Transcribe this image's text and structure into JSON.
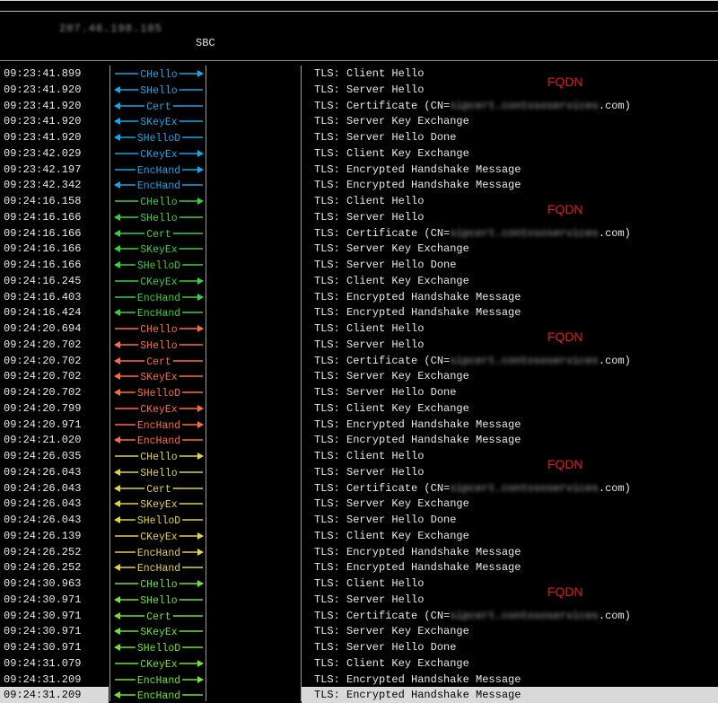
{
  "header": {
    "host_ip": "207.46.198.185",
    "sbc_label": "SBC"
  },
  "fqdn_label": "FQDN",
  "messages": [
    {
      "time": "09:23:41.899",
      "arrow": "CHello",
      "dir": "right",
      "color": "#19a6e6",
      "desc": "TLS: Client Hello"
    },
    {
      "time": "09:23:41.920",
      "arrow": "SHello",
      "dir": "left",
      "color": "#19a6e6",
      "desc": "TLS: Server Hello"
    },
    {
      "time": "09:23:41.920",
      "arrow": "Cert",
      "dir": "left",
      "color": "#19a6e6",
      "desc_prefix": "TLS: Certificate (CN=",
      "desc_blurred": "sipcert.contososervices",
      "desc_suffix": ".com)"
    },
    {
      "time": "09:23:41.920",
      "arrow": "SKeyEx",
      "dir": "left",
      "color": "#19a6e6",
      "desc": "TLS: Server Key Exchange"
    },
    {
      "time": "09:23:41.920",
      "arrow": "SHelloD",
      "dir": "left",
      "color": "#19a6e6",
      "desc": "TLS: Server Hello Done"
    },
    {
      "time": "09:23:42.029",
      "arrow": "CKeyEx",
      "dir": "right",
      "color": "#19a6e6",
      "desc": "TLS: Client Key Exchange"
    },
    {
      "time": "09:23:42.197",
      "arrow": "EncHand",
      "dir": "right",
      "color": "#19a6e6",
      "desc": "TLS: Encrypted Handshake Message"
    },
    {
      "time": "09:23:42.342",
      "arrow": "EncHand",
      "dir": "left",
      "color": "#19a6e6",
      "desc": "TLS: Encrypted Handshake Message"
    },
    {
      "time": "09:24:16.158",
      "arrow": "CHello",
      "dir": "right",
      "color": "#3ccf3c",
      "desc": "TLS: Client Hello"
    },
    {
      "time": "09:24:16.166",
      "arrow": "SHello",
      "dir": "left",
      "color": "#3ccf3c",
      "desc": "TLS: Server Hello"
    },
    {
      "time": "09:24:16.166",
      "arrow": "Cert",
      "dir": "left",
      "color": "#3ccf3c",
      "desc_prefix": "TLS: Certificate (CN=",
      "desc_blurred": "sipcert.contososervices",
      "desc_suffix": ".com)"
    },
    {
      "time": "09:24:16.166",
      "arrow": "SKeyEx",
      "dir": "left",
      "color": "#3ccf3c",
      "desc": "TLS: Server Key Exchange"
    },
    {
      "time": "09:24:16.166",
      "arrow": "SHelloD",
      "dir": "left",
      "color": "#3ccf3c",
      "desc": "TLS: Server Hello Done"
    },
    {
      "time": "09:24:16.245",
      "arrow": "CKeyEx",
      "dir": "right",
      "color": "#3ccf3c",
      "desc": "TLS: Client Key Exchange"
    },
    {
      "time": "09:24:16.403",
      "arrow": "EncHand",
      "dir": "right",
      "color": "#3ccf3c",
      "desc": "TLS: Encrypted Handshake Message"
    },
    {
      "time": "09:24:16.424",
      "arrow": "EncHand",
      "dir": "left",
      "color": "#3ccf3c",
      "desc": "TLS: Encrypted Handshake Message"
    },
    {
      "time": "09:24:20.694",
      "arrow": "CHello",
      "dir": "right",
      "color": "#ff6b3d",
      "desc": "TLS: Client Hello"
    },
    {
      "time": "09:24:20.702",
      "arrow": "SHello",
      "dir": "left",
      "color": "#ff6b3d",
      "desc": "TLS: Server Hello"
    },
    {
      "time": "09:24:20.702",
      "arrow": "Cert",
      "dir": "left",
      "color": "#ff6b3d",
      "desc_prefix": "TLS: Certificate (CN=",
      "desc_blurred": "sipcert.contososervices",
      "desc_suffix": ".com)"
    },
    {
      "time": "09:24:20.702",
      "arrow": "SKeyEx",
      "dir": "left",
      "color": "#ff6b3d",
      "desc": "TLS: Server Key Exchange"
    },
    {
      "time": "09:24:20.702",
      "arrow": "SHelloD",
      "dir": "left",
      "color": "#ff6b3d",
      "desc": "TLS: Server Hello Done"
    },
    {
      "time": "09:24:20.799",
      "arrow": "CKeyEx",
      "dir": "right",
      "color": "#ff6b3d",
      "desc": "TLS: Client Key Exchange"
    },
    {
      "time": "09:24:20.971",
      "arrow": "EncHand",
      "dir": "right",
      "color": "#ff6b3d",
      "desc": "TLS: Encrypted Handshake Message"
    },
    {
      "time": "09:24:21.020",
      "arrow": "EncHand",
      "dir": "left",
      "color": "#ff6b3d",
      "desc": "TLS: Encrypted Handshake Message"
    },
    {
      "time": "09:24:26.035",
      "arrow": "CHello",
      "dir": "right",
      "color": "#e0d34a",
      "desc": "TLS: Client Hello"
    },
    {
      "time": "09:24:26.043",
      "arrow": "SHello",
      "dir": "left",
      "color": "#e0d34a",
      "desc": "TLS: Server Hello"
    },
    {
      "time": "09:24:26.043",
      "arrow": "Cert",
      "dir": "left",
      "color": "#e0d34a",
      "desc_prefix": "TLS: Certificate (CN=",
      "desc_blurred": "sipcert.contososervices",
      "desc_suffix": ".com)"
    },
    {
      "time": "09:24:26.043",
      "arrow": "SKeyEx",
      "dir": "left",
      "color": "#e0d34a",
      "desc": "TLS: Server Key Exchange"
    },
    {
      "time": "09:24:26.043",
      "arrow": "SHelloD",
      "dir": "left",
      "color": "#e0d34a",
      "desc": "TLS: Server Hello Done"
    },
    {
      "time": "09:24:26.139",
      "arrow": "CKeyEx",
      "dir": "right",
      "color": "#e0d34a",
      "desc": "TLS: Client Key Exchange"
    },
    {
      "time": "09:24:26.252",
      "arrow": "EncHand",
      "dir": "right",
      "color": "#e0d34a",
      "desc": "TLS: Encrypted Handshake Message"
    },
    {
      "time": "09:24:26.252",
      "arrow": "EncHand",
      "dir": "left",
      "color": "#e0d34a",
      "desc": "TLS: Encrypted Handshake Message"
    },
    {
      "time": "09:24:30.963",
      "arrow": "CHello",
      "dir": "right",
      "color": "#6ee23a",
      "desc": "TLS: Client Hello"
    },
    {
      "time": "09:24:30.971",
      "arrow": "SHello",
      "dir": "left",
      "color": "#6ee23a",
      "desc": "TLS: Server Hello"
    },
    {
      "time": "09:24:30.971",
      "arrow": "Cert",
      "dir": "left",
      "color": "#6ee23a",
      "desc_prefix": "TLS: Certificate (CN=",
      "desc_blurred": "sipcert.contososervices",
      "desc_suffix": ".com)"
    },
    {
      "time": "09:24:30.971",
      "arrow": "SKeyEx",
      "dir": "left",
      "color": "#6ee23a",
      "desc": "TLS: Server Key Exchange"
    },
    {
      "time": "09:24:30.971",
      "arrow": "SHelloD",
      "dir": "left",
      "color": "#6ee23a",
      "desc": "TLS: Server Hello Done"
    },
    {
      "time": "09:24:31.079",
      "arrow": "CKeyEx",
      "dir": "right",
      "color": "#6ee23a",
      "desc": "TLS: Client Key Exchange"
    },
    {
      "time": "09:24:31.209",
      "arrow": "EncHand",
      "dir": "right",
      "color": "#6ee23a",
      "desc": "TLS: Encrypted Handshake Message"
    },
    {
      "time": "09:24:31.209",
      "arrow": "EncHand",
      "dir": "left",
      "color": "#6ee23a",
      "desc": "TLS: Encrypted Handshake Message",
      "selected": true
    }
  ]
}
